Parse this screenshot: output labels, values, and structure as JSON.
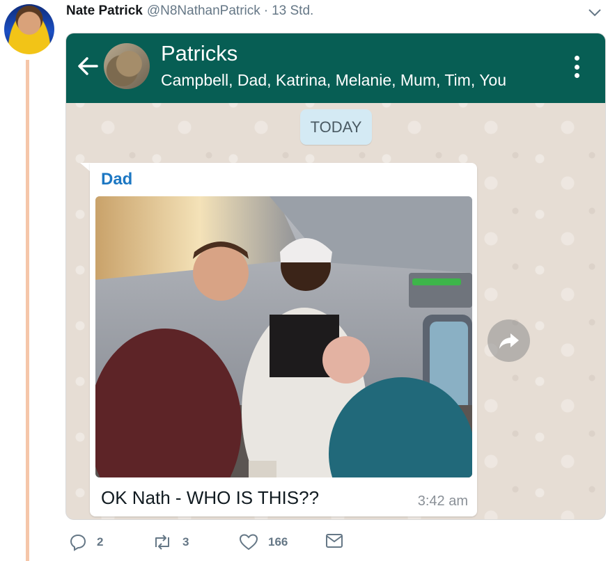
{
  "tweet": {
    "author_name": "Nate Patrick",
    "author_handle": "@N8NathanPatrick",
    "separator": "·",
    "time": "13 Std."
  },
  "chat": {
    "group_title": "Patricks",
    "members": "Campbell, Dad, Katrina, Melanie, Mum, Tim, You",
    "date_chip": "TODAY",
    "message": {
      "sender": "Dad",
      "text": "OK Nath - WHO IS THIS??",
      "time": "3:42 am"
    }
  },
  "actions": {
    "replies": "2",
    "retweets": "3",
    "likes": "166"
  },
  "colors": {
    "whatsapp_header": "#075e54",
    "sender_name": "#1c77c3",
    "date_chip": "#d4eaf4",
    "thread_line": "#f5c6a9",
    "chat_background": "#e6ddd4"
  },
  "icons": {
    "caret": "chevron-down-icon",
    "back": "back-arrow-icon",
    "menu": "more-vertical-icon",
    "forward": "forward-icon",
    "reply": "reply-icon",
    "retweet": "retweet-icon",
    "like": "heart-icon",
    "dm": "envelope-icon"
  }
}
